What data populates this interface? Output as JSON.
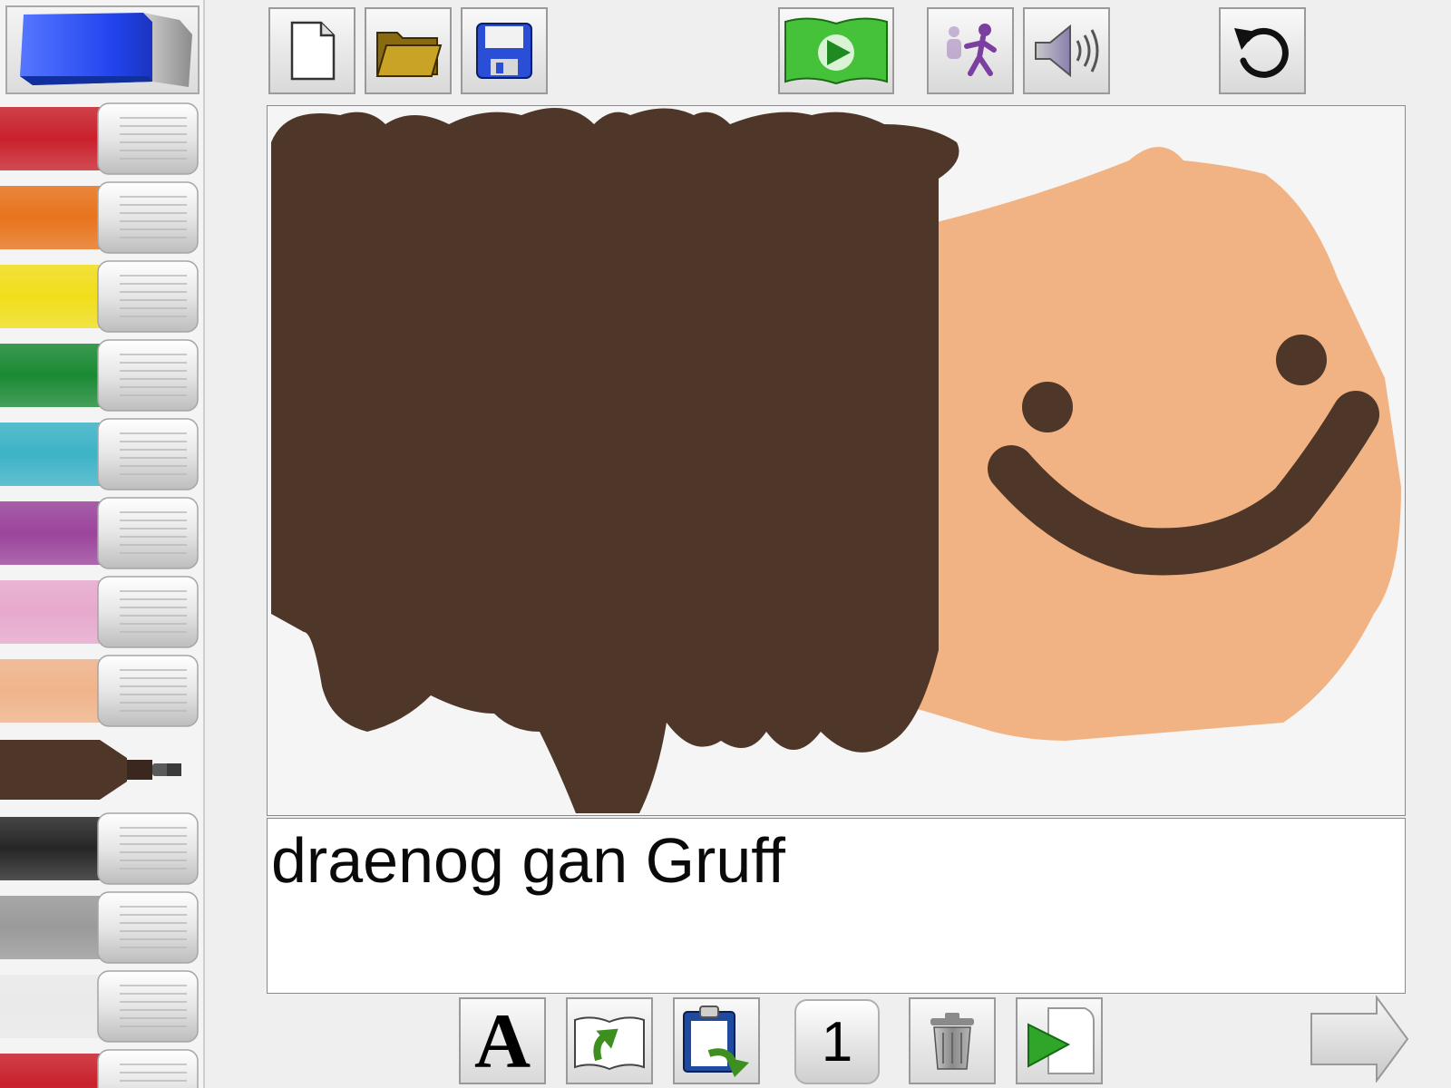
{
  "app": {
    "caption_text": "draenog gan Gruff",
    "page_number": "1"
  },
  "toolbar_top": [
    {
      "name": "new-page-button",
      "icon": "blank-page-icon"
    },
    {
      "name": "open-button",
      "icon": "folder-icon"
    },
    {
      "name": "save-button",
      "icon": "floppy-disk-icon"
    },
    {
      "name": "play-book-button",
      "icon": "play-book-icon"
    },
    {
      "name": "animation-button",
      "icon": "running-figure-icon"
    },
    {
      "name": "sound-button",
      "icon": "speaker-icon"
    },
    {
      "name": "undo-button",
      "icon": "undo-icon"
    }
  ],
  "toolbar_bottom": [
    {
      "name": "font-button",
      "label": "A",
      "icon": "font-icon"
    },
    {
      "name": "import-page-button",
      "icon": "book-arrow-icon"
    },
    {
      "name": "paste-button",
      "icon": "clipboard-icon"
    },
    {
      "name": "page-number-indicator"
    },
    {
      "name": "delete-button",
      "icon": "trash-icon"
    },
    {
      "name": "play-page-button",
      "icon": "play-page-icon"
    },
    {
      "name": "next-page-button",
      "icon": "right-arrow-icon"
    }
  ],
  "palette": {
    "eraser": {
      "icon": "eraser-icon",
      "color": "#2244ee"
    },
    "selected_color": "#4e3629",
    "markers": [
      {
        "name": "red",
        "color": "#c9212b"
      },
      {
        "name": "orange",
        "color": "#e8731c"
      },
      {
        "name": "yellow",
        "color": "#f1de1a"
      },
      {
        "name": "green",
        "color": "#1a8a34"
      },
      {
        "name": "cyan",
        "color": "#3cb3c6"
      },
      {
        "name": "purple",
        "color": "#9b449b"
      },
      {
        "name": "pink",
        "color": "#e7a9cd"
      },
      {
        "name": "peach",
        "color": "#f0b48a"
      },
      {
        "name": "brown",
        "color": "#4e3629"
      },
      {
        "name": "black",
        "color": "#262626"
      },
      {
        "name": "gray",
        "color": "#9a9a9a"
      },
      {
        "name": "white",
        "color": "#eaeaea"
      },
      {
        "name": "red-2",
        "color": "#c9212b"
      }
    ]
  },
  "drawing": {
    "skin_color": "#f2b384",
    "hair_color": "#4e3629"
  }
}
